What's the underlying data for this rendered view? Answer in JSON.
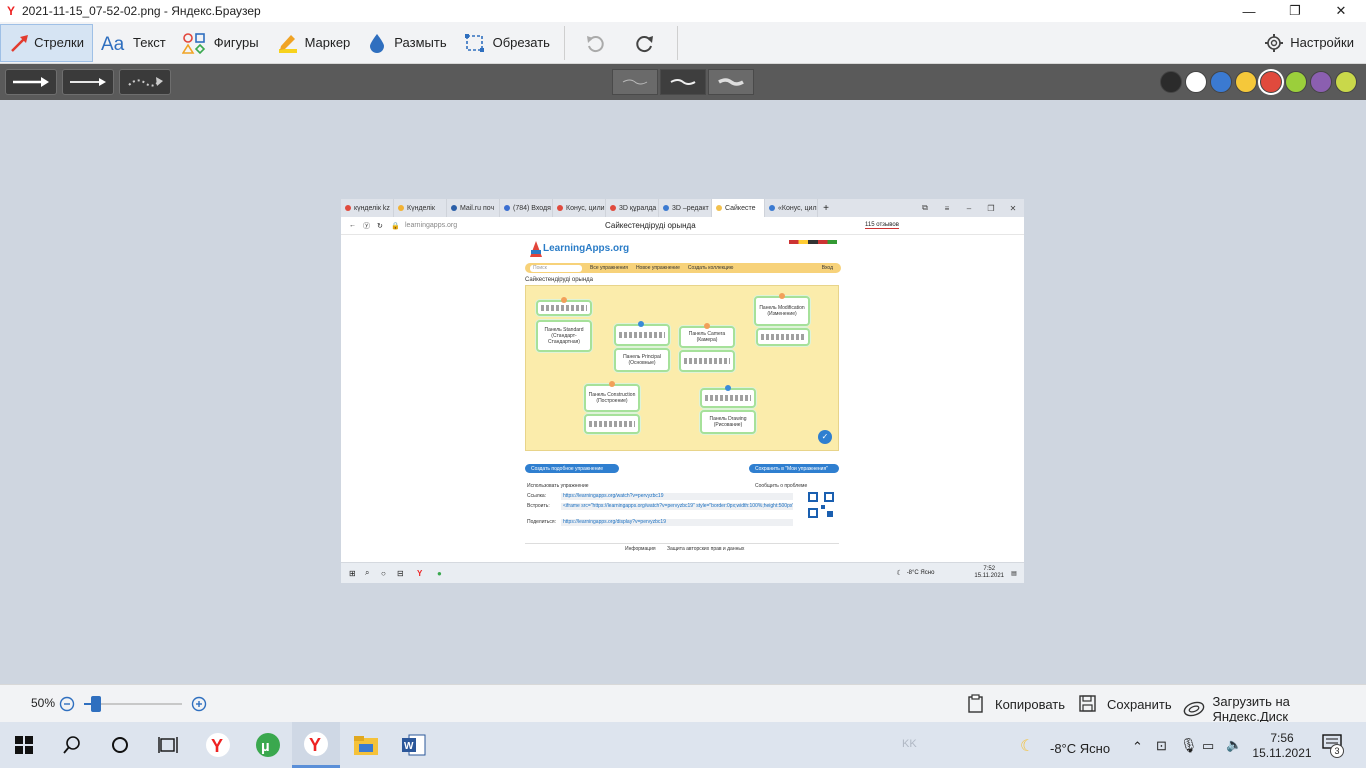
{
  "window": {
    "title": "2021-11-15_07-52-02.png - Яндекс.Браузер",
    "minimize": "—",
    "maximize": "❐",
    "close": "✕"
  },
  "toolbar": {
    "tools": [
      {
        "label": "Стрелки"
      },
      {
        "label": "Текст"
      },
      {
        "label": "Фигуры"
      },
      {
        "label": "Маркер"
      },
      {
        "label": "Размыть"
      },
      {
        "label": "Обрезать"
      }
    ],
    "settings_label": "Настройки",
    "colors": [
      "#2b2b2b",
      "#ffffff",
      "#3b7ad1",
      "#f5c83a",
      "#e04a3d",
      "#9bcf3b",
      "#8b5fb0",
      "#c9d84a"
    ]
  },
  "browser": {
    "tabs": [
      {
        "label": "күнделік kz",
        "color": "#e04a3d"
      },
      {
        "label": "Күнделік",
        "color": "#f2b233"
      },
      {
        "label": "Mail.ru поч",
        "color": "#2b5fa8"
      },
      {
        "label": "(784) Входя",
        "color": "#3b6fd1"
      },
      {
        "label": "Конус, цили",
        "color": "#e04a3d"
      },
      {
        "label": "3D құралда",
        "color": "#e04a3d"
      },
      {
        "label": "3D –редакт",
        "color": "#3b7ad1"
      },
      {
        "label": "Сайкесте",
        "color": "#f2c14e"
      },
      {
        "label": "«Конус, цили",
        "color": "#3b7ad1"
      }
    ],
    "url": "learningapps.org",
    "page_title": "Сайкестендіруді орында",
    "reviews": "115 отзывов"
  },
  "learningapps": {
    "logo": "LearningApps.org",
    "nav": {
      "search": "Поиск",
      "all": "Все упражнения",
      "new": "Новое упражнение",
      "collection": "Создать коллекцию",
      "login": "Вход"
    },
    "crumb": "Сайкестендіруді орында",
    "cards": [
      {
        "text": "Панель Standard (Стандарт- Стандартная)"
      },
      {
        "text": "Панель Principal (Основные)"
      },
      {
        "text": "Панель Camera (Камера)"
      },
      {
        "text": "Панель Modification (Изменение)"
      },
      {
        "text": "Панель Construction (Построение)"
      },
      {
        "text": "Панель Drawing (Рисование)"
      }
    ],
    "btn_similar": "Создать подобное упражнение",
    "btn_save": "Сохранить в \"Мои упражнения\"",
    "use_title": "Использовать упражнение",
    "report": "Сообщить о проблеме",
    "link_label": "Ссылка:",
    "link_value": "https://learningapps.org/watch?v=pervyzbc19",
    "embed_label": "Встроить:",
    "embed_value": "<iframe src=\"https://learningapps.org/watch?v=pervyzbc19\" style=\"border:0px;width:100%;height:500px\" allowfull",
    "share_label": "Поделиться:",
    "share_value": "https://learningapps.org/display?v=pervyzbc19",
    "footer_info": "Информация",
    "footer_rights": "Защита авторских прав и данных"
  },
  "inner_taskbar": {
    "weather": "-8°C  Ясно",
    "time": "7:52",
    "date": "15.11.2021"
  },
  "bottom": {
    "zoom": "50%",
    "zoom_level": 0.12,
    "copy": "Копировать",
    "save": "Сохранить",
    "upload": "Загрузить на Яндекс.Диск"
  },
  "taskbar": {
    "weather": "-8°C  Ясно",
    "time": "7:56",
    "date": "15.11.2021",
    "lang": "KK",
    "notif": "3"
  }
}
